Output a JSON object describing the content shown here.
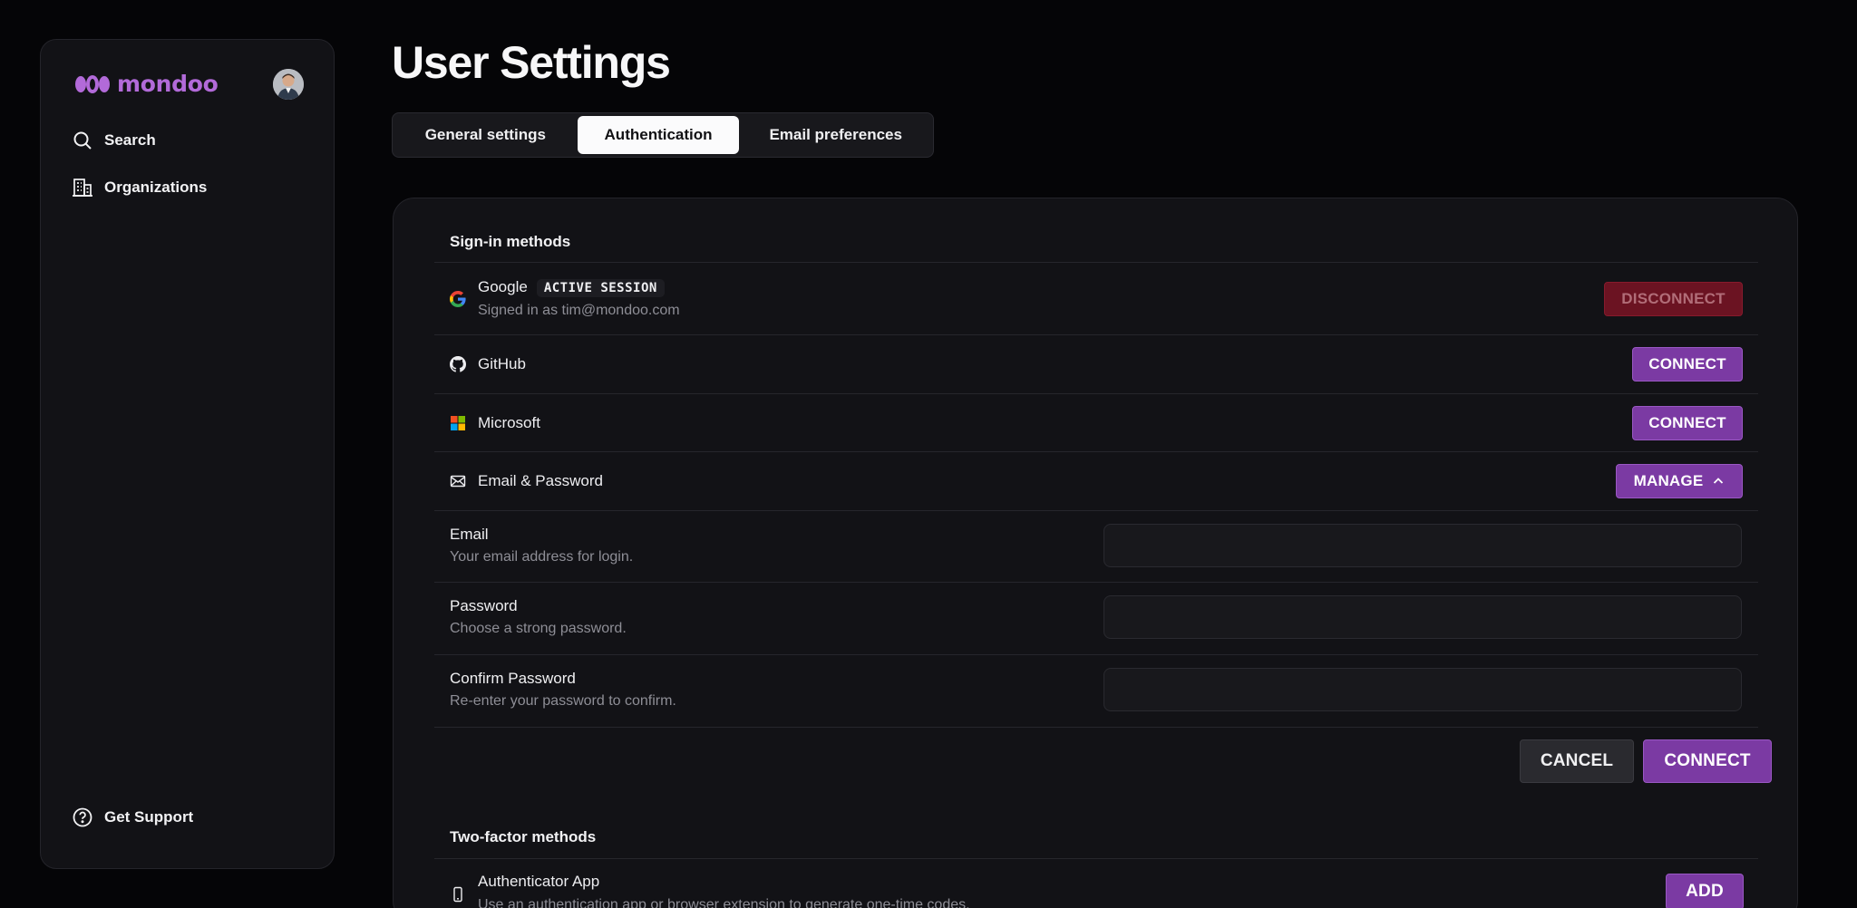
{
  "sidebar": {
    "logo_text": "mondoo",
    "brand_color": "#b26ad9",
    "nav": [
      {
        "label": "Search",
        "icon": "search-icon"
      },
      {
        "label": "Organizations",
        "icon": "building-icon"
      }
    ],
    "support_label": "Get Support"
  },
  "page": {
    "title": "User Settings",
    "tabs": [
      {
        "label": "General settings",
        "active": false
      },
      {
        "label": "Authentication",
        "active": true
      },
      {
        "label": "Email preferences",
        "active": false
      }
    ]
  },
  "signin": {
    "title": "Sign-in methods",
    "google": {
      "label": "Google",
      "badge": "ACTIVE SESSION",
      "sub": "Signed in as tim@mondoo.com",
      "button": "DISCONNECT"
    },
    "github": {
      "label": "GitHub",
      "button": "CONNECT"
    },
    "microsoft": {
      "label": "Microsoft",
      "button": "CONNECT"
    },
    "email_password": {
      "label": "Email & Password",
      "button": "MANAGE"
    },
    "form": {
      "email": {
        "label": "Email",
        "sub": "Your email address for login.",
        "value": ""
      },
      "password": {
        "label": "Password",
        "sub": "Choose a strong password.",
        "value": ""
      },
      "confirm": {
        "label": "Confirm Password",
        "sub": "Re-enter your password to confirm.",
        "value": ""
      },
      "cancel": "CANCEL",
      "connect": "CONNECT"
    }
  },
  "twofactor": {
    "title": "Two-factor methods",
    "authenticator": {
      "label": "Authenticator App",
      "sub": "Use an authentication app or browser extension to generate one-time codes.",
      "button": "ADD"
    }
  }
}
